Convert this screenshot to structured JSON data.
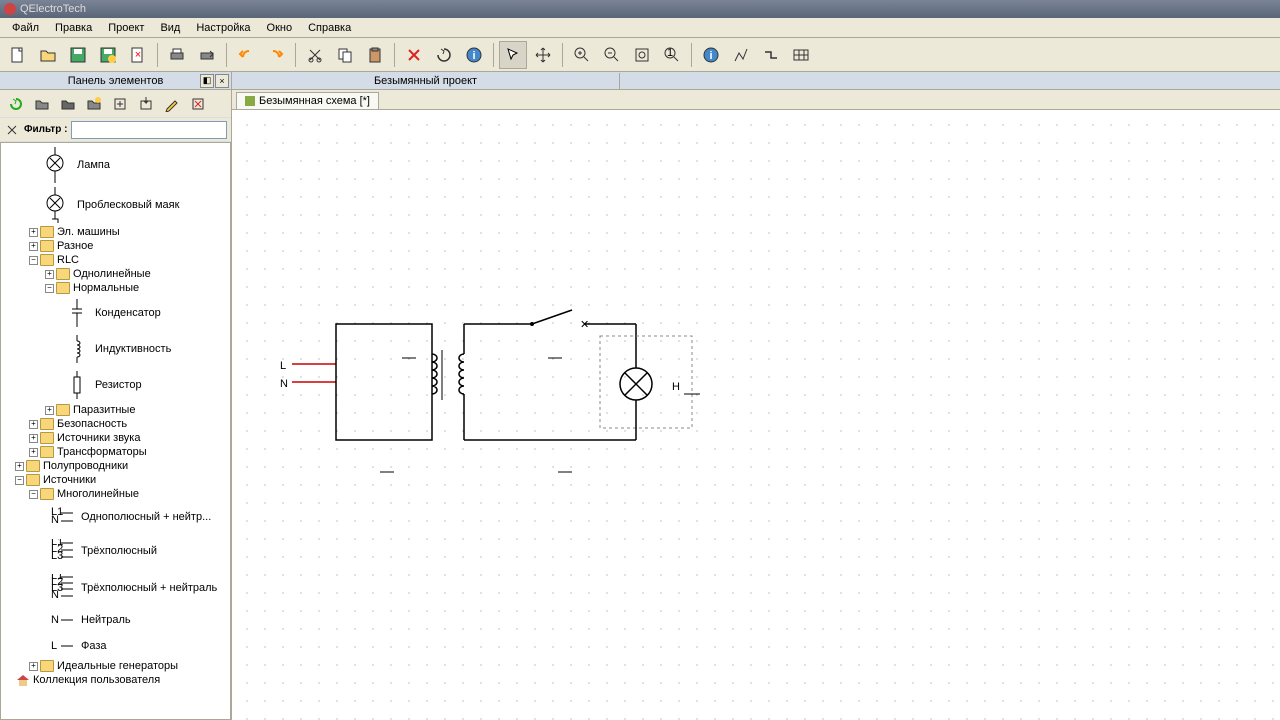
{
  "app": {
    "title": "QElectroTech"
  },
  "menu": [
    "Файл",
    "Правка",
    "Проект",
    "Вид",
    "Настройка",
    "Окно",
    "Справка"
  ],
  "sidebar": {
    "panel_title": "Панель элементов",
    "filter_label": "Фильтр :",
    "filter_value": "",
    "tree": {
      "lampa": "Лампа",
      "problesk": "Проблесковый маяк",
      "el_machines": "Эл. машины",
      "raznoe": "Разное",
      "rlc": "RLC",
      "odnolin": "Однолинейные",
      "normal": "Нормальные",
      "kondensator": "Конденсатор",
      "indukt": "Индуктивность",
      "rezistor": "Резистор",
      "parazit": "Паразитные",
      "bezopas": "Безопасность",
      "ist_zvuka": "Источники звука",
      "transform": "Трансформаторы",
      "poluprov": "Полупроводники",
      "istochniki": "Источники",
      "mnogolin": "Многолинейные",
      "odnopol_neutr": "Однополюсный + нейтр...",
      "trehpol": "Трёхполюсный",
      "trehpol_neutr": "Трёхполюсный + нейтраль",
      "neutral": "Нейтраль",
      "faza": "Фаза",
      "ideal_gen": "Идеальные генераторы",
      "user_coll": "Коллекция пользователя"
    }
  },
  "main": {
    "project_tab": "Безымянный проект",
    "scheme_tab": "Безымянная схема [*]",
    "schematic": {
      "L": "L",
      "N": "N",
      "H": "H"
    }
  }
}
